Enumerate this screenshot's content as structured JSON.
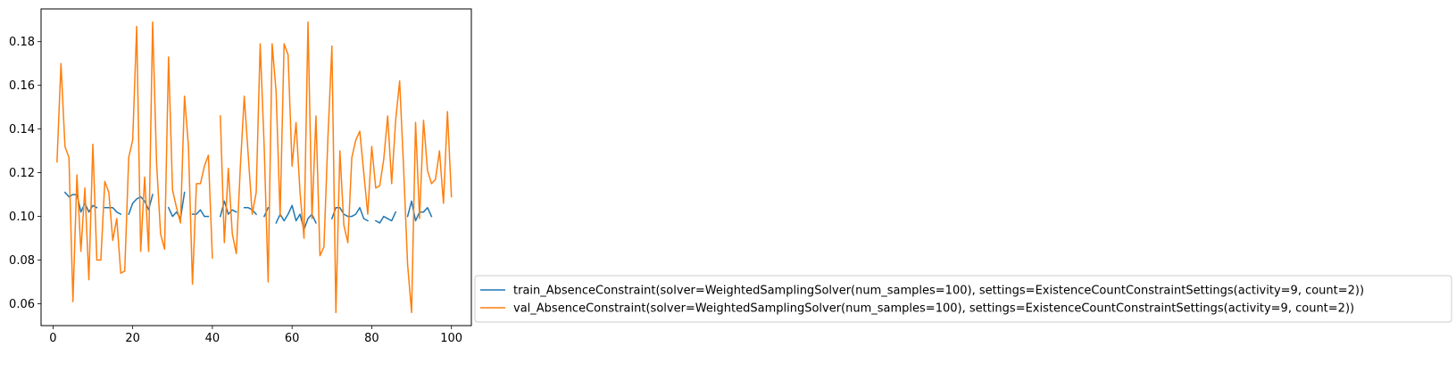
{
  "chart_data": {
    "type": "line",
    "title": "",
    "xlabel": "",
    "ylabel": "",
    "xlim": [
      -3,
      105
    ],
    "ylim": [
      0.05,
      0.195
    ],
    "xticks": [
      0,
      20,
      40,
      60,
      80,
      100
    ],
    "yticks": [
      0.06,
      0.08,
      0.1,
      0.12,
      0.14,
      0.16,
      0.18
    ],
    "grid": false,
    "legend_position": "outside-lower-right",
    "series": [
      {
        "name": "train_AbsenceConstraint(solver=WeightedSamplingSolver(num_samples=100), settings=ExistenceCountConstraintSettings(activity=9, count=2))",
        "color": "#1f77b4",
        "x": [
          3,
          4,
          5,
          6,
          7,
          8,
          9,
          10,
          11,
          null,
          13,
          14,
          15,
          16,
          17,
          null,
          19,
          20,
          21,
          22,
          23,
          24,
          25,
          null,
          29,
          30,
          31,
          32,
          33,
          null,
          35,
          36,
          37,
          38,
          39,
          null,
          42,
          43,
          44,
          45,
          46,
          null,
          48,
          49,
          50,
          51,
          null,
          53,
          54,
          null,
          56,
          57,
          58,
          59,
          60,
          61,
          62,
          63,
          64,
          65,
          66,
          null,
          70,
          71,
          72,
          73,
          74,
          75,
          76,
          77,
          78,
          79,
          null,
          81,
          82,
          83,
          84,
          85,
          86,
          null,
          89,
          90,
          91,
          92,
          93,
          94,
          95
        ],
        "y": [
          0.111,
          0.109,
          0.11,
          0.11,
          0.102,
          0.106,
          0.102,
          0.105,
          0.104,
          null,
          0.104,
          0.104,
          0.104,
          0.102,
          0.101,
          null,
          0.101,
          0.106,
          0.108,
          0.109,
          0.107,
          0.103,
          0.11,
          null,
          0.104,
          0.1,
          0.102,
          0.099,
          0.111,
          null,
          0.101,
          0.101,
          0.103,
          0.1,
          0.1,
          null,
          0.1,
          0.107,
          0.101,
          0.103,
          0.102,
          null,
          0.104,
          0.104,
          0.103,
          0.101,
          null,
          0.1,
          0.104,
          null,
          0.097,
          0.101,
          0.098,
          0.101,
          0.105,
          0.098,
          0.101,
          0.094,
          0.099,
          0.101,
          0.097,
          null,
          0.099,
          0.104,
          0.104,
          0.101,
          0.1,
          0.1,
          0.101,
          0.104,
          0.099,
          0.098,
          null,
          0.098,
          0.097,
          0.1,
          0.099,
          0.098,
          0.102,
          null,
          0.1,
          0.107,
          0.098,
          0.102,
          0.102,
          0.104,
          0.1
        ]
      },
      {
        "name": "val_AbsenceConstraint(solver=WeightedSamplingSolver(num_samples=100), settings=ExistenceCountConstraintSettings(activity=9, count=2))",
        "color": "#ff7f0e",
        "x": [
          1,
          2,
          3,
          4,
          5,
          6,
          7,
          8,
          9,
          10,
          11,
          12,
          13,
          14,
          15,
          16,
          17,
          18,
          19,
          20,
          21,
          22,
          23,
          24,
          25,
          26,
          27,
          28,
          29,
          30,
          31,
          32,
          33,
          34,
          35,
          36,
          37,
          38,
          39,
          40,
          null,
          42,
          43,
          44,
          45,
          46,
          47,
          48,
          49,
          50,
          51,
          52,
          53,
          54,
          55,
          56,
          57,
          58,
          59,
          60,
          61,
          62,
          63,
          64,
          65,
          66,
          67,
          68,
          69,
          70,
          71,
          72,
          73,
          74,
          75,
          76,
          77,
          78,
          79,
          80,
          81,
          82,
          83,
          84,
          85,
          86,
          87,
          88,
          89,
          90,
          91,
          92,
          93,
          94,
          95,
          96,
          97,
          98,
          99,
          100
        ],
        "y": [
          0.125,
          0.17,
          0.132,
          0.127,
          0.061,
          0.119,
          0.084,
          0.113,
          0.071,
          0.133,
          0.08,
          0.08,
          0.116,
          0.111,
          0.089,
          0.099,
          0.074,
          0.075,
          0.127,
          0.135,
          0.187,
          0.084,
          0.118,
          0.084,
          0.189,
          0.124,
          0.092,
          0.085,
          0.173,
          0.112,
          0.104,
          0.097,
          0.155,
          0.132,
          0.069,
          0.115,
          0.115,
          0.123,
          0.128,
          0.081,
          null,
          0.146,
          0.088,
          0.122,
          0.092,
          0.083,
          0.122,
          0.155,
          0.128,
          0.101,
          0.111,
          0.179,
          0.132,
          0.07,
          0.179,
          0.157,
          0.1,
          0.179,
          0.174,
          0.123,
          0.143,
          0.111,
          0.09,
          0.189,
          0.099,
          0.146,
          0.082,
          0.086,
          0.136,
          0.178,
          0.056,
          0.13,
          0.096,
          0.088,
          0.127,
          0.135,
          0.139,
          0.12,
          0.101,
          0.132,
          0.113,
          0.114,
          0.126,
          0.146,
          0.115,
          0.144,
          0.162,
          0.122,
          0.078,
          0.056,
          0.143,
          0.099,
          0.144,
          0.121,
          0.115,
          0.117,
          0.13,
          0.106,
          0.148,
          0.109
        ]
      }
    ]
  }
}
